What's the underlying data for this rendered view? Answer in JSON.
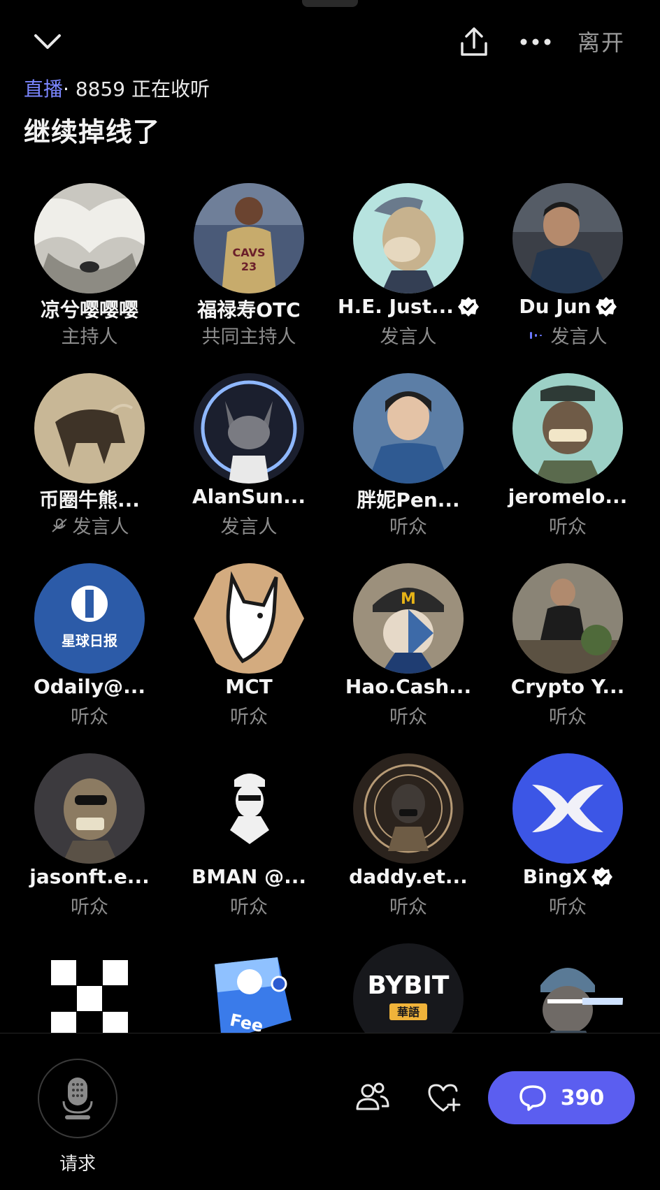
{
  "header": {
    "leave_label": "离开",
    "live_label": "直播",
    "separator": "·",
    "listening_count": "8859 正在收听",
    "title": "继续掉线了"
  },
  "colors": {
    "accent": "#5b5ef0",
    "live": "#7b86ff",
    "verified": "#ffffff"
  },
  "participants": [
    {
      "name": "凉兮嘤嘤嘤",
      "role": "主持人",
      "verified": false,
      "avatar": "white-fabric-photo"
    },
    {
      "name": "福禄寿OTC",
      "role": "共同主持人",
      "verified": false,
      "avatar": "basketball-player-photo"
    },
    {
      "name": "H.E. Just...",
      "role": "发言人",
      "verified": true,
      "avatar": "cartoon-ape-mint"
    },
    {
      "name": "Du Jun",
      "role": "发言人",
      "verified": true,
      "speaking": true,
      "avatar": "man-photo"
    },
    {
      "name": "币圈牛熊...",
      "role": "发言人",
      "verified": false,
      "muted": true,
      "avatar": "bull-illustration"
    },
    {
      "name": "AlanSun...",
      "role": "发言人",
      "verified": false,
      "avatar": "cartoon-cat-neon"
    },
    {
      "name": "胖妮Pen...",
      "role": "听众",
      "verified": false,
      "avatar": "woman-denim-photo"
    },
    {
      "name": "jeromelo...",
      "role": "听众",
      "verified": false,
      "avatar": "cartoon-ape-cap"
    },
    {
      "name": "Odaily@...",
      "role": "听众",
      "verified": false,
      "avatar": "odaily-logo",
      "logo_text": "星球日报"
    },
    {
      "name": "MCT",
      "role": "听众",
      "verified": false,
      "avatar": "fox-logo"
    },
    {
      "name": "Hao.Cash...",
      "role": "听众",
      "verified": false,
      "avatar": "anime-cap-girl"
    },
    {
      "name": "Crypto Y...",
      "role": "听众",
      "verified": false,
      "avatar": "man-workshop-photo"
    },
    {
      "name": "jasonft.e...",
      "role": "听众",
      "verified": false,
      "avatar": "skeleton-ape"
    },
    {
      "name": "BMAN @...",
      "role": "听众",
      "verified": false,
      "avatar": "man-cap-sketch"
    },
    {
      "name": "daddy.et...",
      "role": "听众",
      "verified": false,
      "avatar": "dark-ornate-ape"
    },
    {
      "name": "BingX",
      "role": "听众",
      "verified": true,
      "avatar": "bingx-logo"
    },
    {
      "name": "",
      "role": "",
      "avatar": "okx-logo"
    },
    {
      "name": "",
      "role": "",
      "avatar": "fee-wallet-logo",
      "logo_text": "Fee"
    },
    {
      "name": "",
      "role": "",
      "avatar": "bybit-logo",
      "logo_text": "BYBIT",
      "logo_subtext": "華語"
    },
    {
      "name": "",
      "role": "",
      "avatar": "laser-eyes-ape"
    }
  ],
  "bottom": {
    "request_label": "请求",
    "comments_count": "390"
  }
}
